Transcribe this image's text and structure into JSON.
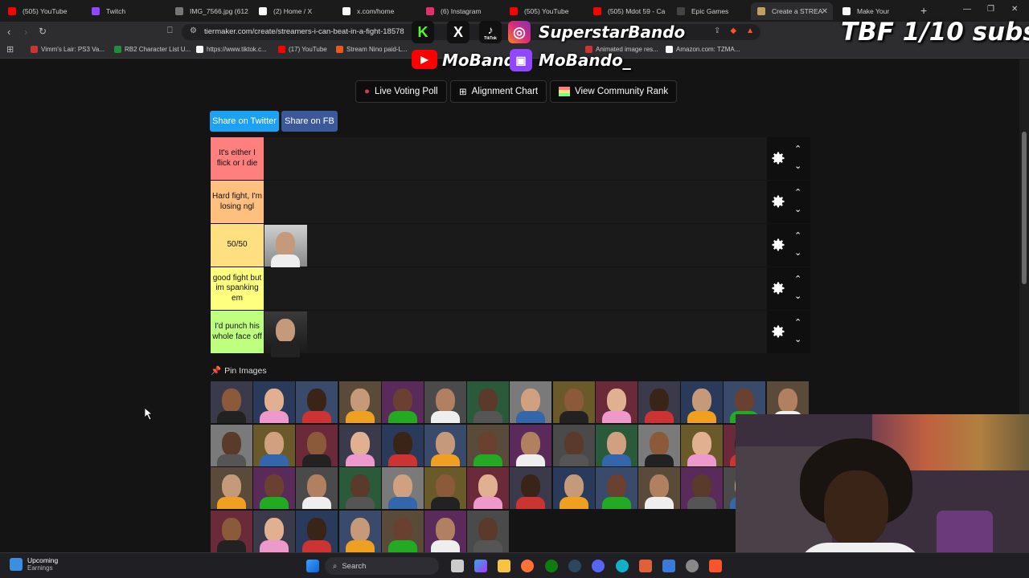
{
  "browser": {
    "tabs": [
      {
        "label": "(505) YouTube",
        "color": "#ff0000"
      },
      {
        "label": "Twitch",
        "color": "#9146ff"
      },
      {
        "label": "IMG_7566.jpg (612…",
        "color": "#888888"
      },
      {
        "label": "(2) Home / X",
        "color": "#ffffff"
      },
      {
        "label": "x.com/home",
        "color": "#ffffff"
      },
      {
        "label": "(6) Instagram",
        "color": "#e1306c"
      },
      {
        "label": "(505) YouTube",
        "color": "#ff0000"
      },
      {
        "label": "(505) Mdot 59 - Ca",
        "color": "#ff0000"
      },
      {
        "label": "Epic Games",
        "color": "#333333"
      },
      {
        "label": "Create a STREA",
        "color": "#c0a060"
      },
      {
        "label": "Make Your",
        "color": "#ffffff"
      }
    ],
    "url": "tiermaker.com/create/streamers-i-can-beat-in-a-fight-18578",
    "bookmarks": [
      "Vimm's Lair: PS3 Va...",
      "RB2 Character List U...",
      "https://www.tiktok.c...",
      "(17) YouTube",
      "Stream Nino paid-L...",
      "Animated image res...",
      "Amazon.com: TZMA..."
    ]
  },
  "overlay": {
    "handle_top": "SuperstarBando",
    "handle_bottom_youtube": "MoBando",
    "handle_bottom_twitch": "MoBando_",
    "subs": "TBF 1/10 subs",
    "tiktok_label": "TikTok"
  },
  "tiermaker": {
    "buttons": {
      "live_voting": "Live Voting Poll",
      "alignment": "Alignment Chart",
      "community": "View Community Rank"
    },
    "share": {
      "twitter": "Share on Twitter",
      "fb": "Share on FB"
    },
    "tiers": [
      {
        "label": "It's either I flick or I die",
        "color": "#ff7f7f",
        "images": 0
      },
      {
        "label": "Hard fight, I'm losing ngl",
        "color": "#ffbf7f",
        "images": 0
      },
      {
        "label": "50/50",
        "color": "#ffdf7f",
        "images": 1
      },
      {
        "label": "good fight but im spanking em",
        "color": "#ffff7f",
        "images": 0
      },
      {
        "label": "I'd punch his whole face off",
        "color": "#bfff7f",
        "images": 1
      }
    ],
    "pin_images_label": "Pin Images",
    "pool_rows": [
      14,
      13,
      13,
      7
    ]
  },
  "taskbar": {
    "weather_title": "Upcoming",
    "weather_sub": "Earnings",
    "search_placeholder": "Search"
  },
  "colors": {
    "twitter_btn": "#1da1f2",
    "fb_btn": "#3b5998",
    "page_bg": "#141414"
  }
}
